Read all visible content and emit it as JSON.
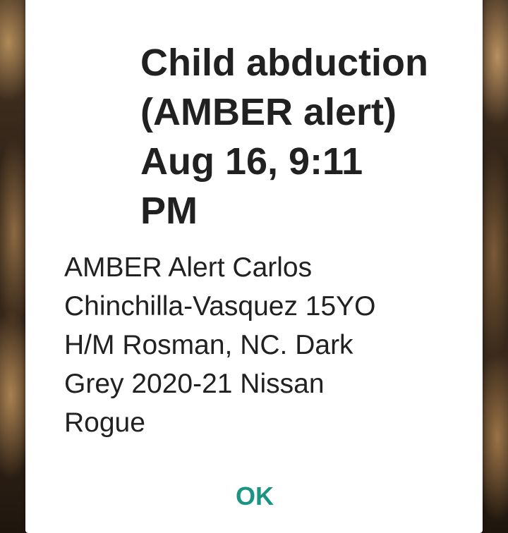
{
  "alert_dialog": {
    "title_lines": [
      "Child abduction",
      "(AMBER alert)",
      "Aug 16, 9:11",
      "PM"
    ],
    "message_lines": [
      "AMBER Alert Carlos",
      "Chinchilla-Vasquez 15YO",
      "H/M Rosman, NC. Dark",
      "Grey 2020-21 Nissan",
      "Rogue"
    ],
    "ok_label": "OK"
  },
  "colors": {
    "dialog_background": "#ffffff",
    "text": "#212121",
    "accent": "#1a9583"
  }
}
